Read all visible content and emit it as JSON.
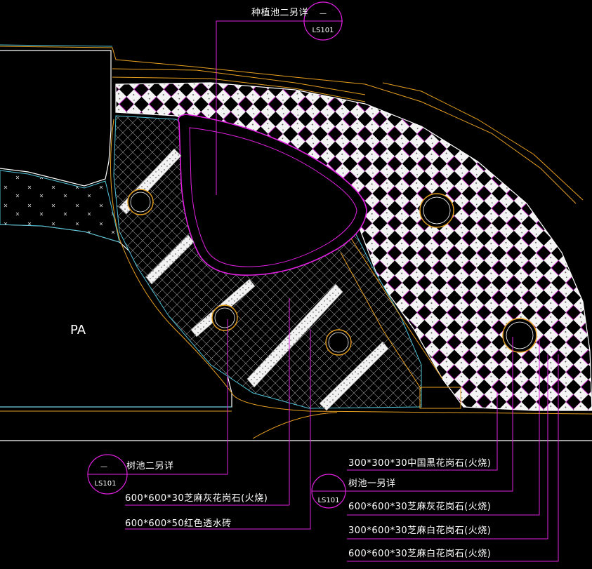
{
  "drawing": {
    "area_label": "PA",
    "callouts": {
      "planter_two_top": {
        "text": "种植池二另详",
        "bubble_top": "—",
        "bubble_bottom": "LS101"
      },
      "tree_pit_two": {
        "text": "树池二另详",
        "bubble_top": "—",
        "bubble_bottom": "LS101"
      },
      "tree_pit_one": {
        "text": "树池一另详",
        "bubble_bottom": "LS101"
      }
    },
    "materials": [
      "300*300*30中国黑花岗石(火烧)",
      "600*600*30芝麻灰花岗石(火烧)",
      "300*600*30芝麻白花岗石(火烧)",
      "600*600*30芝麻白花岗石(火烧)",
      "600*600*30芝麻灰花岗石(火烧)",
      "600*600*50红色透水砖"
    ]
  },
  "colors": {
    "background": "#000000",
    "leader": "#e020e0",
    "boundary": "#ffffff",
    "edge_orange": "#e8a020",
    "edge_cyan": "#4fc3d8",
    "hatch": "#cfcfcf",
    "tree_ring": "#e8a020"
  }
}
